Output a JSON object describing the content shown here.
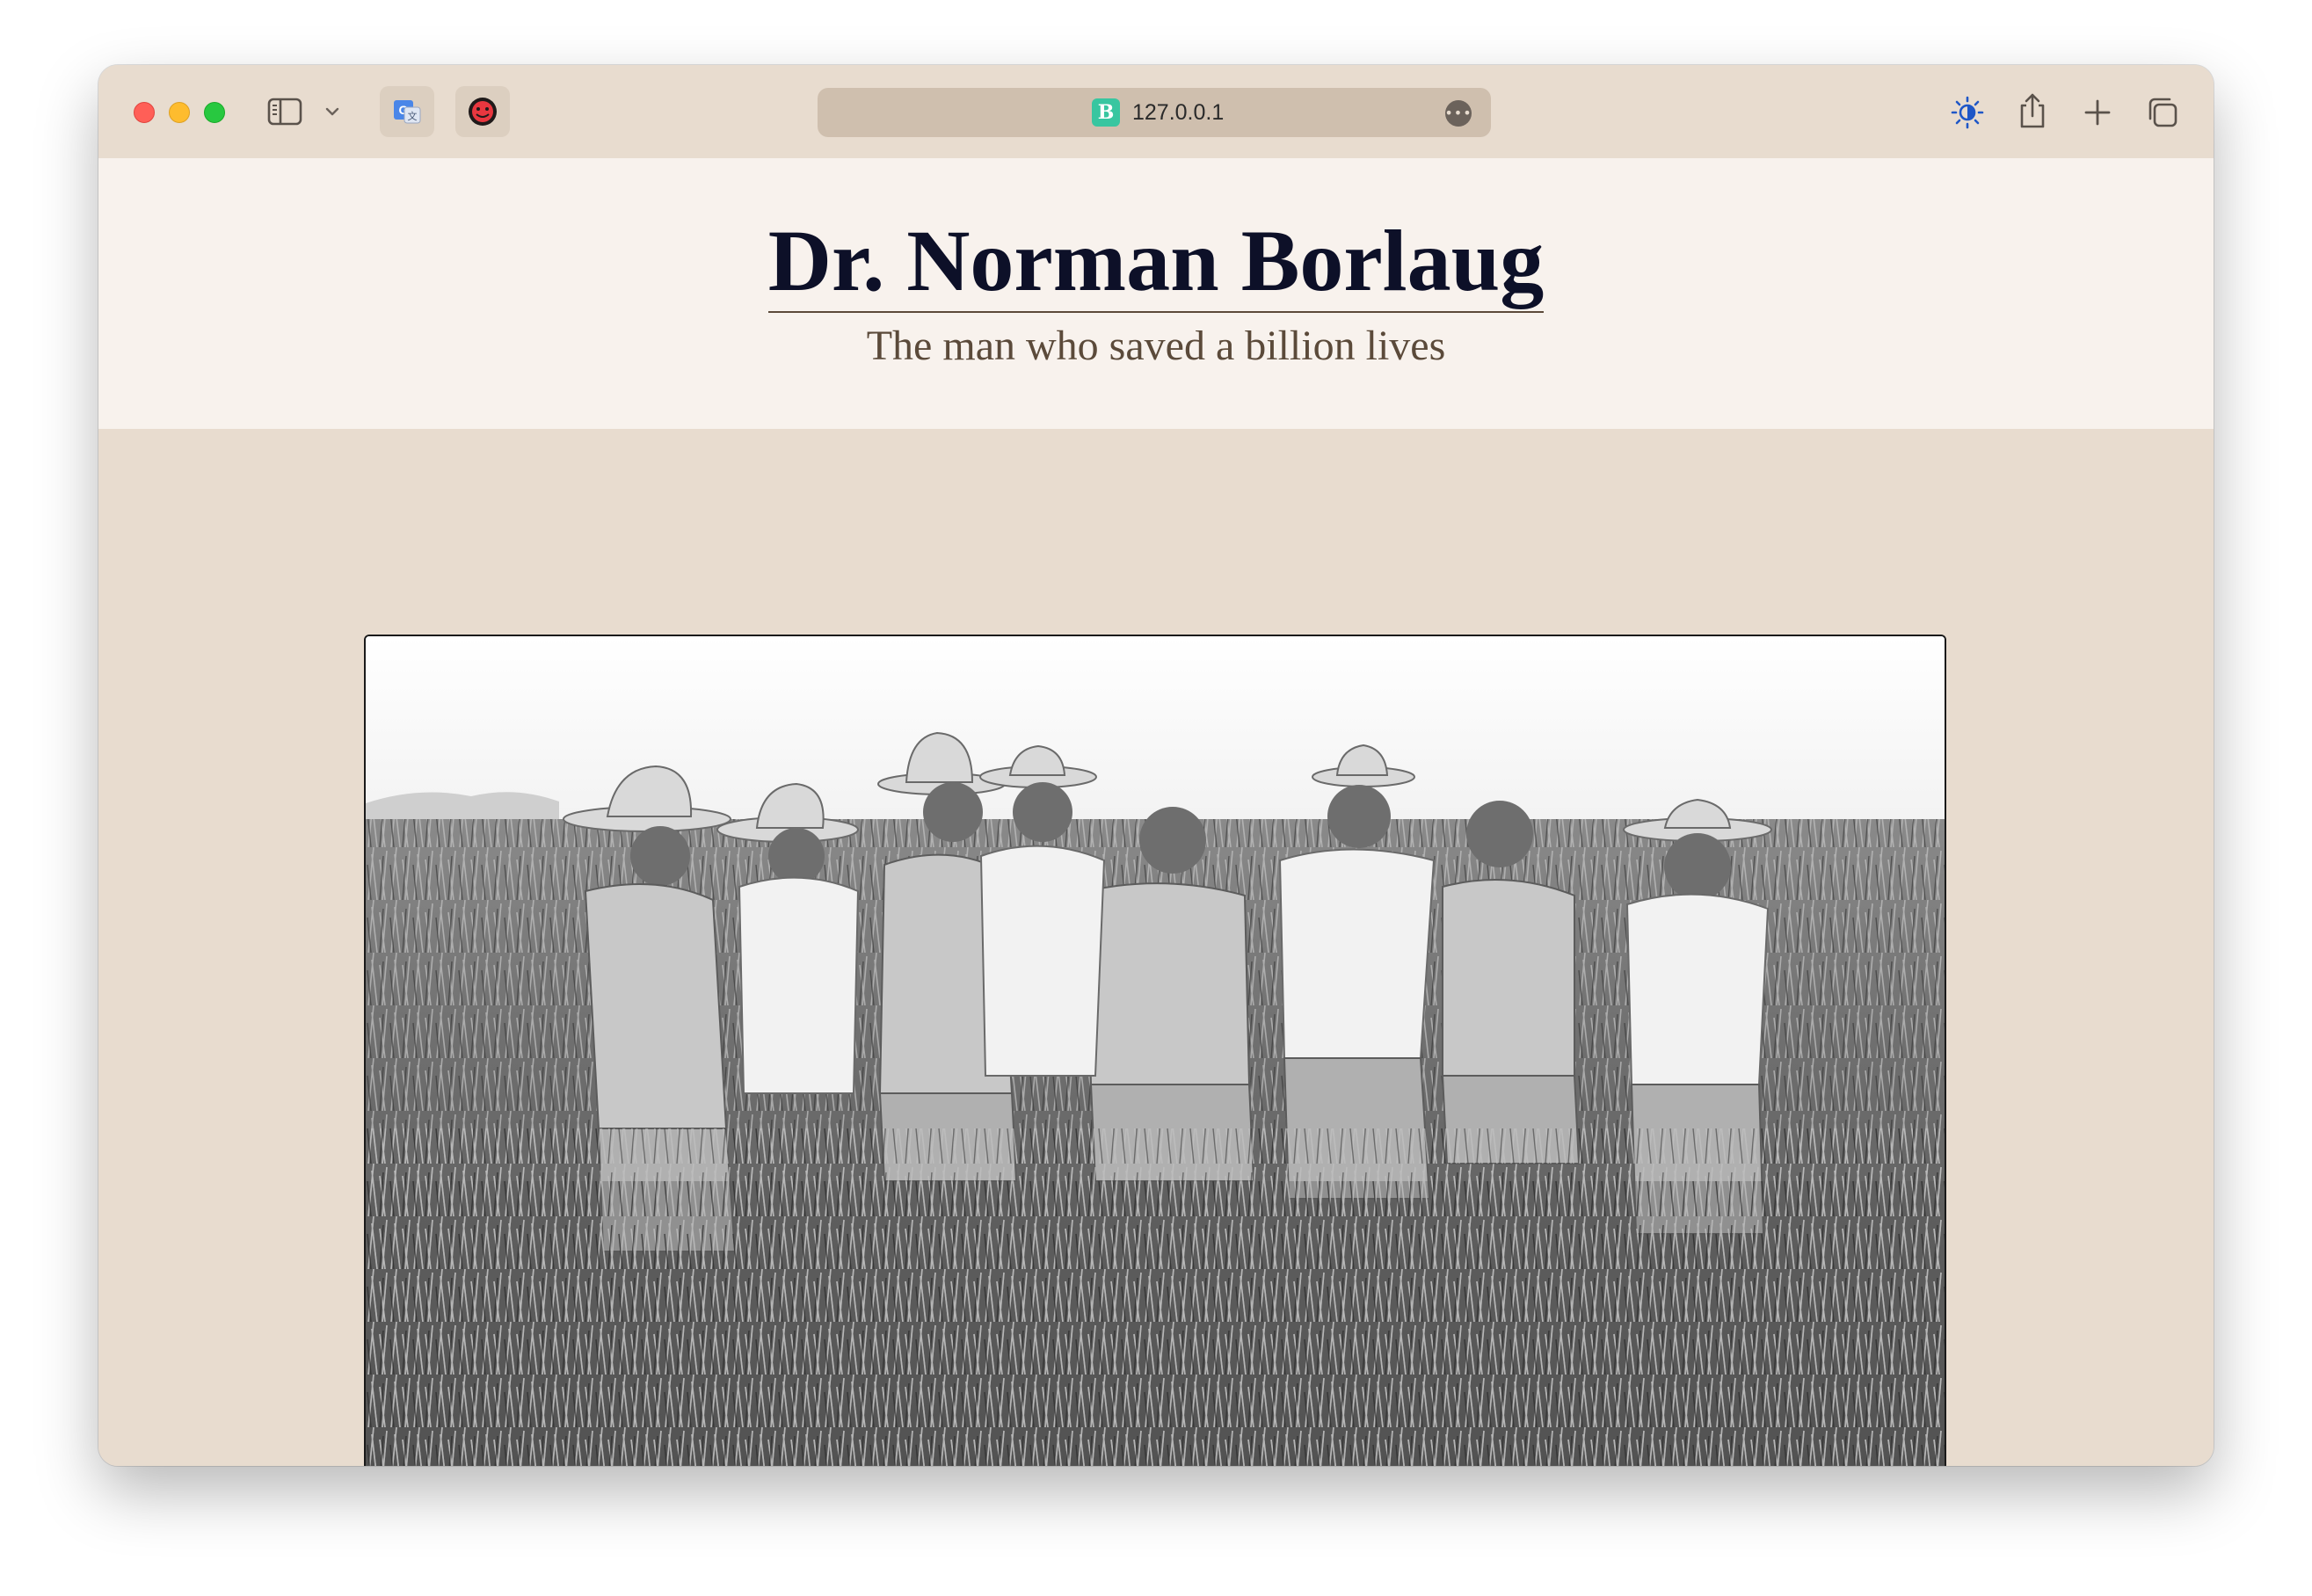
{
  "browser": {
    "url": "127.0.0.1",
    "site_icon_letter": "B",
    "icons": {
      "close": "close-light",
      "minimize": "minimize-light",
      "maximize": "maximize-light",
      "sidebar": "sidebar-icon",
      "translate_extension": "translate-icon",
      "face_extension": "face-icon",
      "page_menu": "ellipsis-icon",
      "appearance": "brightness-icon",
      "share": "share-icon",
      "new_tab": "plus-icon",
      "tab_overview": "tabs-icon"
    },
    "colors": {
      "chrome": "#e8dccf",
      "url_bar": "#cfbfae",
      "site_icon": "#38c6a0"
    }
  },
  "page": {
    "title": "Dr. Norman Borlaug",
    "subtitle": "The man who saved a billion lives",
    "colors": {
      "header_bg": "#f8f2ed",
      "body_bg": "#e8dccf",
      "title": "#0d1028",
      "subtitle": "#5b4a3a"
    }
  }
}
